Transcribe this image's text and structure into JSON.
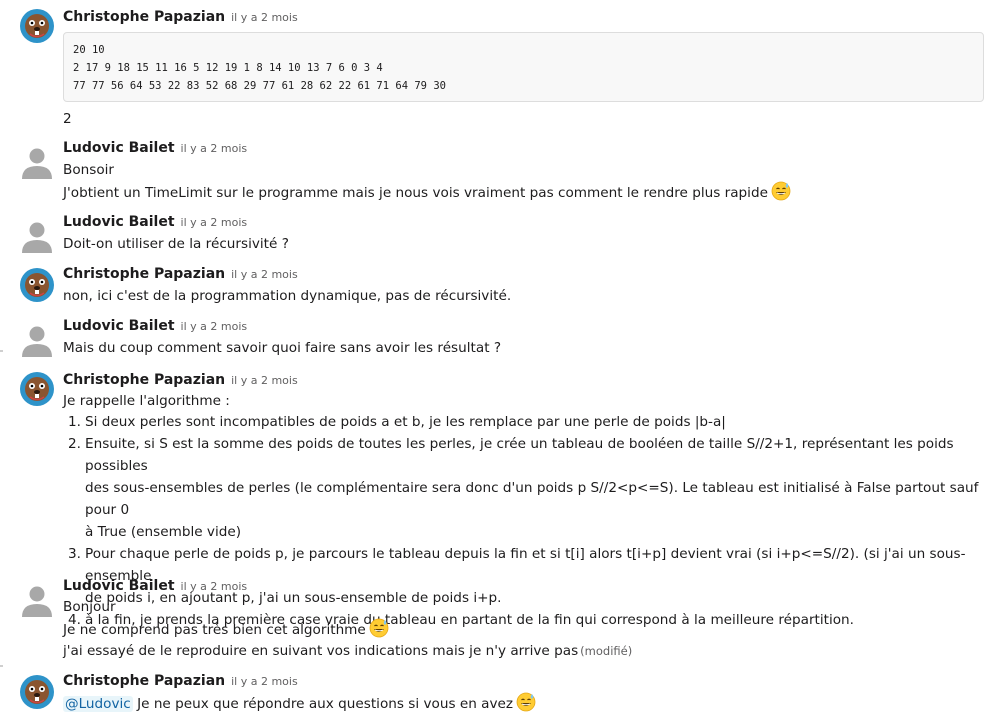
{
  "messages": [
    {
      "author": "Christophe Papazian",
      "time": "il y a 2 mois",
      "code": [
        "20 10",
        "2 17 9 18 15 11 16 5 12 19 1 8 14 10 13 7 6 0 3 4",
        "77 77 56 64 53 22 83 52 68 29 77 61 28 62 22 61 71 64 79 30"
      ],
      "text": "2"
    },
    {
      "author": "Ludovic Bailet",
      "time": "il y a 2 mois",
      "lines": [
        "Bonsoir",
        "J'obtient un TimeLimit sur le programme mais je nous vois vraiment pas comment le rendre plus rapide"
      ]
    },
    {
      "author": "Ludovic Bailet",
      "time": "il y a 2 mois",
      "text": "Doit-on utiliser de la récursivité ?"
    },
    {
      "author": "Christophe Papazian",
      "time": "il y a 2 mois",
      "text": "non, ici c'est de la programmation dynamique, pas de récursivité."
    },
    {
      "author": "Ludovic Bailet",
      "time": "il y a 2 mois",
      "text": "Mais du coup comment savoir quoi faire sans avoir les résultat ?"
    },
    {
      "author": "Christophe Papazian",
      "time": "il y a 2 mois",
      "intro": "Je rappelle l'algorithme :",
      "steps": [
        {
          "num": "1.",
          "lines": [
            "Si deux perles sont incompatibles de poids a et b, je les remplace par une perle de poids |b-a|"
          ]
        },
        {
          "num": "2.",
          "lines": [
            "Ensuite, si S est la somme des poids de toutes les perles, je crée un tableau de booléen de taille S//2+1, représentant les poids possibles",
            "des sous-ensembles de perles (le complémentaire sera donc d'un poids p S//2<p<=S). Le tableau est initialisé à False partout sauf pour 0",
            "à True (ensemble vide)"
          ]
        },
        {
          "num": "3.",
          "lines": [
            "Pour chaque perle de poids p, je parcours le tableau depuis la fin et si t[i] alors t[i+p] devient vrai (si i+p<=S//2). (si j'ai un sous-ensemble",
            "de poids i, en ajoutant p, j'ai un sous-ensemble de poids i+p."
          ]
        },
        {
          "num": "4.",
          "lines": [
            "à la fin, je prends la première case vraie du tableau en partant de la fin qui correspond à la meilleure répartition."
          ]
        }
      ]
    },
    {
      "author": "Ludovic Bailet",
      "time": "il y a 2 mois",
      "lines": [
        "Bonjour",
        "Je ne comprend pas très bien cet algorithme",
        "j'ai essayé de le reproduire en suivant vos indications mais je n'y arrive pas"
      ],
      "edited": "(modifié)"
    },
    {
      "author": "Christophe Papazian",
      "time": "il y a 2 mois",
      "mention": "@Ludovic",
      "text": "Je ne peux que répondre aux questions si vous en avez"
    }
  ],
  "emoji_name": "sweat-smile-emoji",
  "colors": {
    "mention_bg": "#e8f5fa",
    "mention_text": "#1264a3",
    "code_bg": "#f8f8f8",
    "time": "#616061"
  }
}
